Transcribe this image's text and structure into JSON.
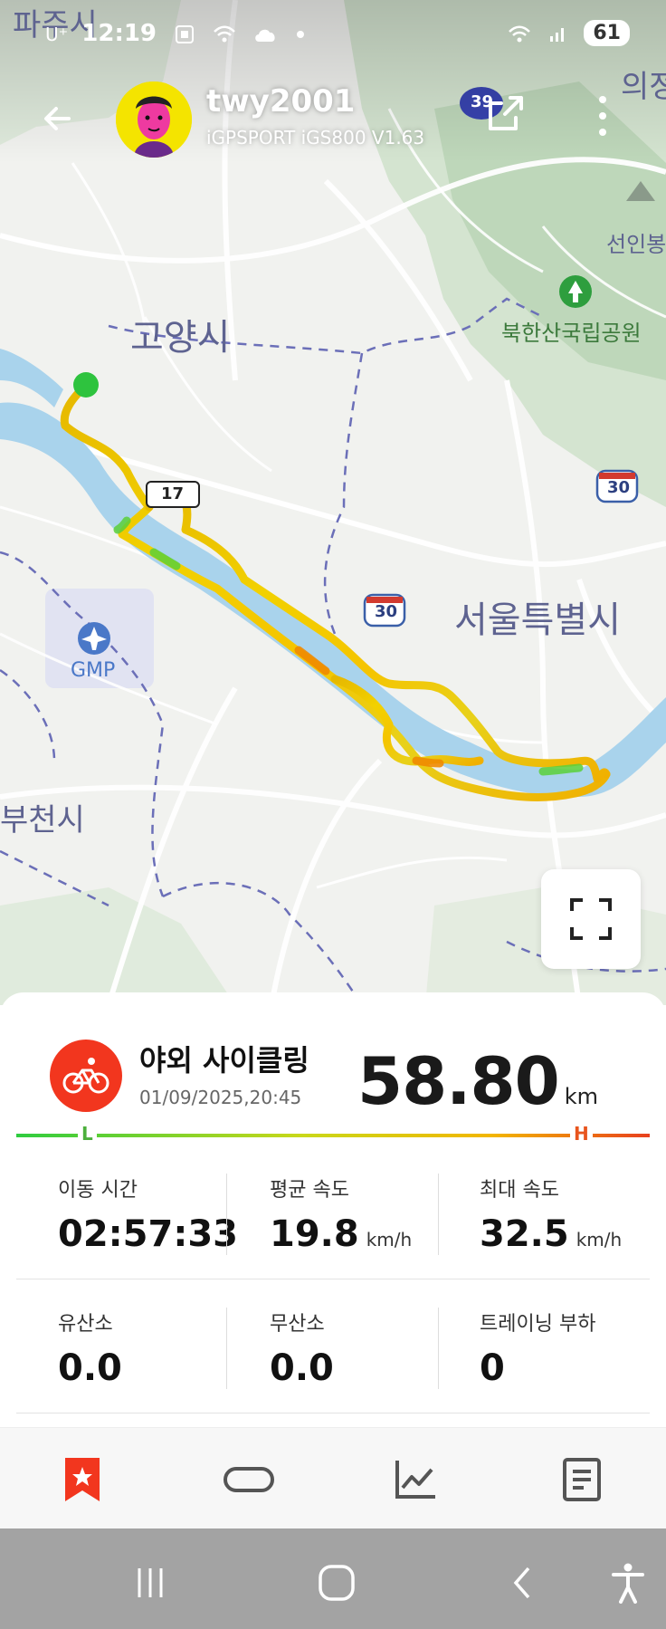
{
  "status_bar": {
    "carrier": "U⁺",
    "time": "12:19",
    "battery": "61"
  },
  "header": {
    "username": "twy2001",
    "device": "iGPSPORT iGS800  V1.63"
  },
  "map": {
    "labels": {
      "paju": "파주시",
      "uijeong": "의정",
      "goyang": "고양시",
      "seonin": "선인봉",
      "bukhansan": "북한산국립공원",
      "seoul": "서울특별시",
      "gmp": "GMP",
      "bucheon": "부천시",
      "route30a": "30",
      "route30b": "30",
      "route39": "39",
      "route17": "17"
    }
  },
  "activity": {
    "name": "야외 사이클링",
    "date": "01/09/2025,20:45",
    "distance": "58.80",
    "distance_unit": "km",
    "legend_low": "L",
    "legend_high": "H"
  },
  "stats": [
    {
      "label": "이동 시간",
      "value": "02:57:33",
      "unit": ""
    },
    {
      "label": "평균 속도",
      "value": "19.8",
      "unit": "km/h"
    },
    {
      "label": "최대 속도",
      "value": "32.5",
      "unit": "km/h"
    },
    {
      "label": "유산소",
      "value": "0.0",
      "unit": ""
    },
    {
      "label": "무산소",
      "value": "0.0",
      "unit": ""
    },
    {
      "label": "트레이닝 부하",
      "value": "0",
      "unit": ""
    }
  ],
  "colors": {
    "accent": "#f2361e",
    "route_low": "#2ecc40",
    "route_high": "#e8551e",
    "river": "#a9d3ec"
  },
  "tabs": [
    "summary-star",
    "laps",
    "charts",
    "details"
  ]
}
